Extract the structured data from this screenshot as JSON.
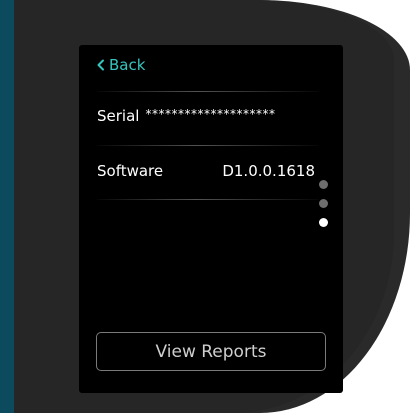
{
  "screen": {
    "back_label": "Back",
    "serial_label": "Serial",
    "serial_value": "********************",
    "software_label": "Software",
    "software_value": "D1.0.0.1618",
    "view_reports_label": "View Reports"
  },
  "pager": {
    "total_pages": 3,
    "active_page": 3
  },
  "colors": {
    "accent": "#37c4bd",
    "screen_bg": "#000000",
    "bezel": "#2a2a2a",
    "side_strip": "#0c4a5e"
  },
  "icons": {
    "back": "chevron-left-icon"
  }
}
